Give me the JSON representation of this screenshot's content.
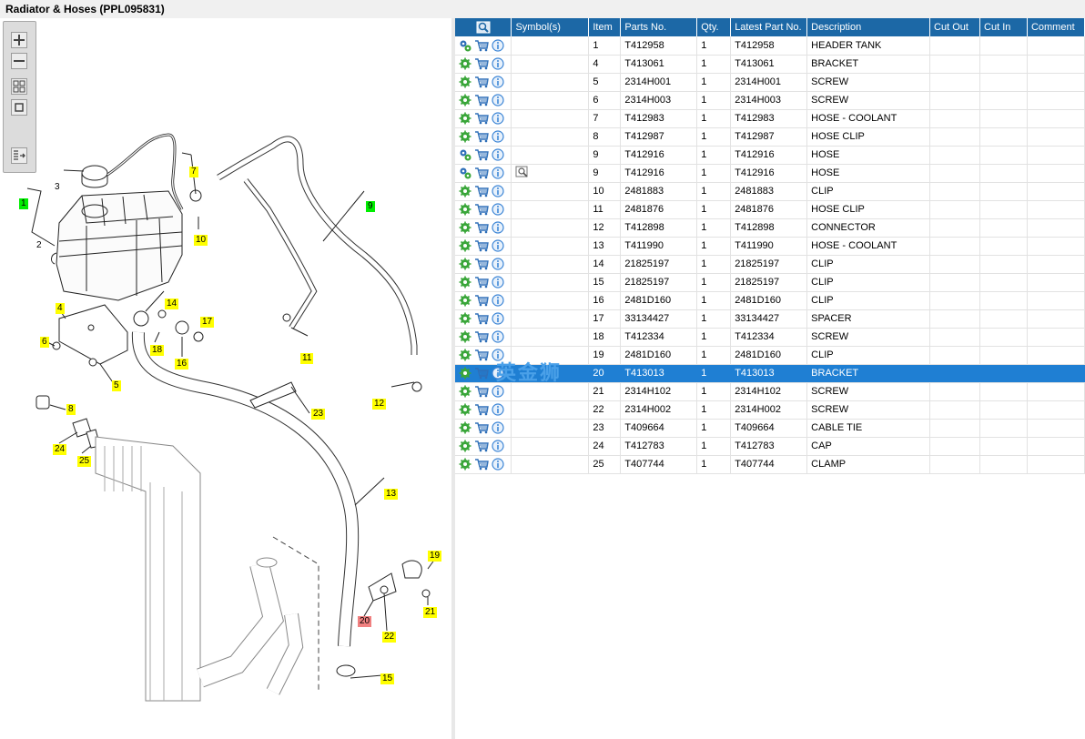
{
  "window": {
    "title": "Radiator & Hoses (PPL095831)"
  },
  "toolbar": {
    "buttons": [
      {
        "name": "zoom-in-button",
        "icon": "zoom-in-icon"
      },
      {
        "name": "zoom-out-button",
        "icon": "zoom-out-icon"
      },
      {
        "name": "fit-all-button",
        "icon": "fit-grid-icon"
      },
      {
        "name": "actual-size-button",
        "icon": "square-icon"
      },
      {
        "name": "export-button",
        "icon": "export-icon"
      }
    ]
  },
  "diagram": {
    "callouts": [
      {
        "label": "1",
        "style": "green"
      },
      {
        "label": "2",
        "style": "plain"
      },
      {
        "label": "3",
        "style": "plain"
      },
      {
        "label": "4",
        "style": "yellow"
      },
      {
        "label": "5",
        "style": "yellow"
      },
      {
        "label": "6",
        "style": "yellow"
      },
      {
        "label": "7",
        "style": "yellow"
      },
      {
        "label": "8",
        "style": "yellow"
      },
      {
        "label": "9",
        "style": "green"
      },
      {
        "label": "10",
        "style": "yellow"
      },
      {
        "label": "11",
        "style": "yellow"
      },
      {
        "label": "12",
        "style": "yellow"
      },
      {
        "label": "13",
        "style": "yellow"
      },
      {
        "label": "14",
        "style": "yellow"
      },
      {
        "label": "15",
        "style": "yellow"
      },
      {
        "label": "16",
        "style": "yellow"
      },
      {
        "label": "17",
        "style": "yellow"
      },
      {
        "label": "18",
        "style": "yellow"
      },
      {
        "label": "19",
        "style": "yellow"
      },
      {
        "label": "20",
        "style": "red"
      },
      {
        "label": "21",
        "style": "yellow"
      },
      {
        "label": "22",
        "style": "yellow"
      },
      {
        "label": "23",
        "style": "yellow"
      },
      {
        "label": "24",
        "style": "yellow"
      },
      {
        "label": "25",
        "style": "yellow"
      }
    ]
  },
  "grid": {
    "columns": [
      "",
      "Symbol(s)",
      "Item",
      "Parts No.",
      "Qty.",
      "Latest Part No.",
      "Description",
      "Cut Out",
      "Cut In",
      "Comment"
    ],
    "header_icon": "search-parts-icon",
    "rows": [
      {
        "gear": "gears",
        "symbol": "",
        "item": "1",
        "part": "T412958",
        "qty": "1",
        "latest": "T412958",
        "desc": "HEADER TANK",
        "cutout": "",
        "cutin": "",
        "comment": ""
      },
      {
        "gear": "gear",
        "symbol": "",
        "item": "4",
        "part": "T413061",
        "qty": "1",
        "latest": "T413061",
        "desc": "BRACKET",
        "cutout": "",
        "cutin": "",
        "comment": ""
      },
      {
        "gear": "gear",
        "symbol": "",
        "item": "5",
        "part": "2314H001",
        "qty": "1",
        "latest": "2314H001",
        "desc": "SCREW",
        "cutout": "",
        "cutin": "",
        "comment": ""
      },
      {
        "gear": "gear",
        "symbol": "",
        "item": "6",
        "part": "2314H003",
        "qty": "1",
        "latest": "2314H003",
        "desc": "SCREW",
        "cutout": "",
        "cutin": "",
        "comment": ""
      },
      {
        "gear": "gear",
        "symbol": "",
        "item": "7",
        "part": "T412983",
        "qty": "1",
        "latest": "T412983",
        "desc": "HOSE - COOLANT",
        "cutout": "",
        "cutin": "",
        "comment": ""
      },
      {
        "gear": "gear",
        "symbol": "",
        "item": "8",
        "part": "T412987",
        "qty": "1",
        "latest": "T412987",
        "desc": "HOSE CLIP",
        "cutout": "",
        "cutin": "",
        "comment": ""
      },
      {
        "gear": "gears",
        "symbol": "",
        "item": "9",
        "part": "T412916",
        "qty": "1",
        "latest": "T412916",
        "desc": "HOSE",
        "cutout": "",
        "cutin": "",
        "comment": ""
      },
      {
        "gear": "gears",
        "symbol": "view",
        "item": "9",
        "part": "T412916",
        "qty": "1",
        "latest": "T412916",
        "desc": "HOSE",
        "cutout": "",
        "cutin": "",
        "comment": ""
      },
      {
        "gear": "gear",
        "symbol": "",
        "item": "10",
        "part": "2481883",
        "qty": "1",
        "latest": "2481883",
        "desc": "CLIP",
        "cutout": "",
        "cutin": "",
        "comment": ""
      },
      {
        "gear": "gear",
        "symbol": "",
        "item": "11",
        "part": "2481876",
        "qty": "1",
        "latest": "2481876",
        "desc": "HOSE CLIP",
        "cutout": "",
        "cutin": "",
        "comment": ""
      },
      {
        "gear": "gear",
        "symbol": "",
        "item": "12",
        "part": "T412898",
        "qty": "1",
        "latest": "T412898",
        "desc": "CONNECTOR",
        "cutout": "",
        "cutin": "",
        "comment": ""
      },
      {
        "gear": "gear",
        "symbol": "",
        "item": "13",
        "part": "T411990",
        "qty": "1",
        "latest": "T411990",
        "desc": "HOSE - COOLANT",
        "cutout": "",
        "cutin": "",
        "comment": ""
      },
      {
        "gear": "gear",
        "symbol": "",
        "item": "14",
        "part": "21825197",
        "qty": "1",
        "latest": "21825197",
        "desc": "CLIP",
        "cutout": "",
        "cutin": "",
        "comment": ""
      },
      {
        "gear": "gear",
        "symbol": "",
        "item": "15",
        "part": "21825197",
        "qty": "1",
        "latest": "21825197",
        "desc": "CLIP",
        "cutout": "",
        "cutin": "",
        "comment": ""
      },
      {
        "gear": "gear",
        "symbol": "",
        "item": "16",
        "part": "2481D160",
        "qty": "1",
        "latest": "2481D160",
        "desc": "CLIP",
        "cutout": "",
        "cutin": "",
        "comment": ""
      },
      {
        "gear": "gear",
        "symbol": "",
        "item": "17",
        "part": "33134427",
        "qty": "1",
        "latest": "33134427",
        "desc": "SPACER",
        "cutout": "",
        "cutin": "",
        "comment": ""
      },
      {
        "gear": "gear",
        "symbol": "",
        "item": "18",
        "part": "T412334",
        "qty": "1",
        "latest": "T412334",
        "desc": "SCREW",
        "cutout": "",
        "cutin": "",
        "comment": ""
      },
      {
        "gear": "gear",
        "symbol": "",
        "item": "19",
        "part": "2481D160",
        "qty": "1",
        "latest": "2481D160",
        "desc": "CLIP",
        "cutout": "",
        "cutin": "",
        "comment": ""
      },
      {
        "gear": "gear",
        "symbol": "",
        "item": "20",
        "part": "T413013",
        "qty": "1",
        "latest": "T413013",
        "desc": "BRACKET",
        "cutout": "",
        "cutin": "",
        "comment": "",
        "selected": true
      },
      {
        "gear": "gear",
        "symbol": "",
        "item": "21",
        "part": "2314H102",
        "qty": "1",
        "latest": "2314H102",
        "desc": "SCREW",
        "cutout": "",
        "cutin": "",
        "comment": ""
      },
      {
        "gear": "gear",
        "symbol": "",
        "item": "22",
        "part": "2314H002",
        "qty": "1",
        "latest": "2314H002",
        "desc": "SCREW",
        "cutout": "",
        "cutin": "",
        "comment": ""
      },
      {
        "gear": "gear",
        "symbol": "",
        "item": "23",
        "part": "T409664",
        "qty": "1",
        "latest": "T409664",
        "desc": "CABLE TIE",
        "cutout": "",
        "cutin": "",
        "comment": ""
      },
      {
        "gear": "gear",
        "symbol": "",
        "item": "24",
        "part": "T412783",
        "qty": "1",
        "latest": "T412783",
        "desc": "CAP",
        "cutout": "",
        "cutin": "",
        "comment": ""
      },
      {
        "gear": "gear",
        "symbol": "",
        "item": "25",
        "part": "T407744",
        "qty": "1",
        "latest": "T407744",
        "desc": "CLAMP",
        "cutout": "",
        "cutin": "",
        "comment": ""
      }
    ]
  },
  "watermark": {
    "text": "英金狮"
  },
  "colors": {
    "header": "#1c68a6",
    "selected_row": "#1f7fd3",
    "callout_yellow": "#ffff00",
    "callout_green": "#00ee00",
    "callout_red": "#f08080",
    "gear_green": "#3aa63a",
    "cart_blue": "#2e6fb8",
    "info_blue": "#3d86d6"
  }
}
